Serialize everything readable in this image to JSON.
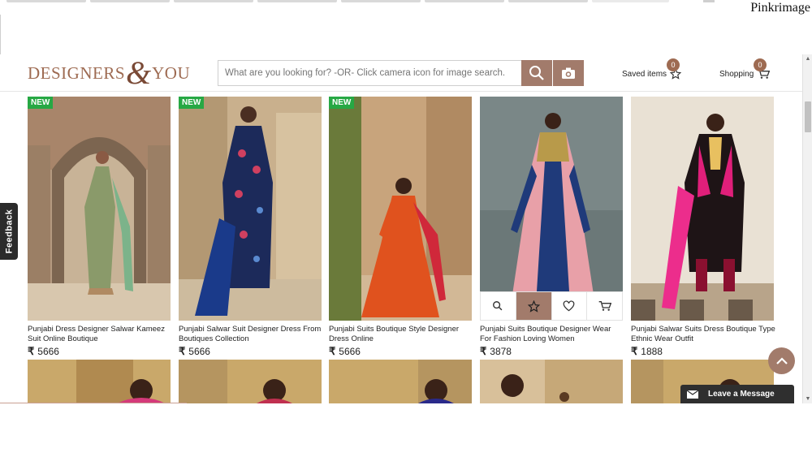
{
  "watermark": "Pinkrimage",
  "header": {
    "logo": {
      "word1": "DESIGNERS",
      "amp": "&",
      "word2": "YOU"
    },
    "search_placeholder": "What are you looking for? -OR- Click camera icon for image search.",
    "saved_label": "Saved items",
    "saved_count": "0",
    "cart_label": "Shopping",
    "cart_count": "0"
  },
  "feedback_label": "Feedback",
  "new_label": "NEW",
  "products": [
    {
      "title": "Punjabi Dress Designer Salwar Kameez Suit Online Boutique",
      "price": "5666"
    },
    {
      "title": "Punjabi Salwar Suit Designer Dress From Boutiques Collection",
      "price": "5666"
    },
    {
      "title": "Punjabi Suits Boutique Style Designer Dress Online",
      "price": "5666"
    },
    {
      "title": "Punjabi Suits Boutique Designer Wear For Fashion Loving Women",
      "price": "3878"
    },
    {
      "title": "Punjabi Salwar Suits Dress Boutique Type Ethnic Wear Outfit",
      "price": "1888"
    }
  ],
  "currency_symbol": "₹",
  "leave_message": "Leave a Message",
  "colors": {
    "brand": "#a27b6b",
    "new_badge": "#27a844"
  }
}
